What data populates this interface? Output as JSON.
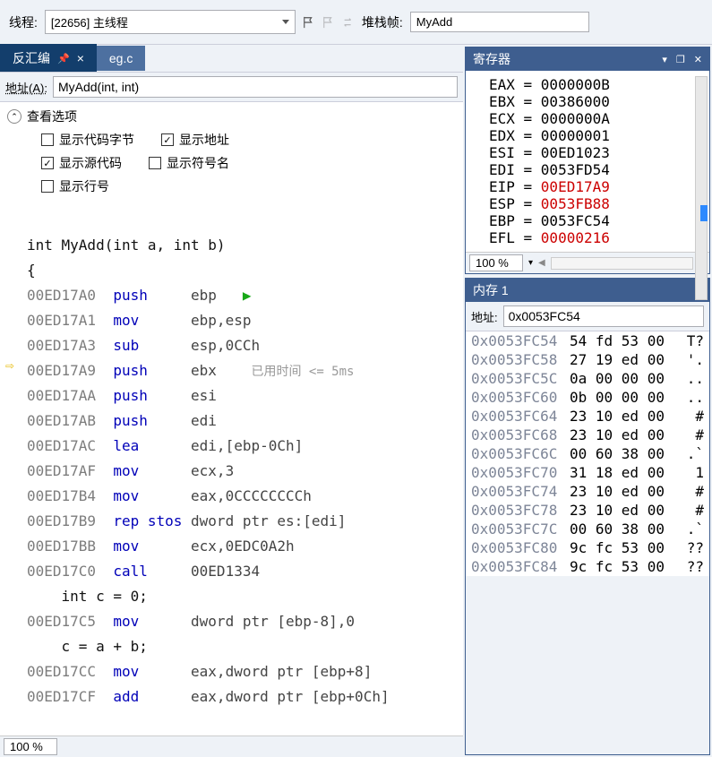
{
  "topbar": {
    "threads_label": "线程:",
    "thread_value": "[22656] 主线程",
    "stack_label": "堆栈帧:",
    "stack_value": "MyAdd"
  },
  "tabs": {
    "active": "反汇编",
    "inactive": "eg.c"
  },
  "address_bar": {
    "label": "地址(A):",
    "value": "MyAdd(int, int)"
  },
  "options": {
    "title": "查看选项",
    "show_code_bytes": "显示代码字节",
    "show_address": "显示地址",
    "show_source": "显示源代码",
    "show_symbol": "显示符号名",
    "show_line": "显示行号"
  },
  "asm": {
    "src_sig": "int MyAdd(int a, int b)",
    "brace_open": "{",
    "lines": [
      {
        "addr": "00ED17A0",
        "op": "push",
        "opd": "ebp",
        "green": true
      },
      {
        "addr": "00ED17A1",
        "op": "mov",
        "opd": "ebp,esp"
      },
      {
        "addr": "00ED17A3",
        "op": "sub",
        "opd": "esp,0CCh"
      },
      {
        "addr": "00ED17A9",
        "op": "push",
        "opd": "ebx",
        "cur": true,
        "hint": "已用时间 <= 5ms"
      },
      {
        "addr": "00ED17AA",
        "op": "push",
        "opd": "esi"
      },
      {
        "addr": "00ED17AB",
        "op": "push",
        "opd": "edi"
      },
      {
        "addr": "00ED17AC",
        "op": "lea",
        "opd": "edi,[ebp-0Ch]"
      },
      {
        "addr": "00ED17AF",
        "op": "mov",
        "opd": "ecx,3"
      },
      {
        "addr": "00ED17B4",
        "op": "mov",
        "opd": "eax,0CCCCCCCCh"
      },
      {
        "addr": "00ED17B9",
        "op": "rep stos",
        "opd": "dword ptr es:[edi]"
      },
      {
        "addr": "00ED17BB",
        "op": "mov",
        "opd": "ecx,0EDC0A2h"
      },
      {
        "addr": "00ED17C0",
        "op": "call",
        "opd": "00ED1334"
      }
    ],
    "src_c0": "int c = 0;",
    "lines2": [
      {
        "addr": "00ED17C5",
        "op": "mov",
        "opd": "dword ptr [ebp-8],0"
      }
    ],
    "src_add": "c = a + b;",
    "lines3": [
      {
        "addr": "00ED17CC",
        "op": "mov",
        "opd": "eax,dword ptr [ebp+8]"
      },
      {
        "addr": "00ED17CF",
        "op": "add",
        "opd": "eax,dword ptr [ebp+0Ch]"
      }
    ]
  },
  "zoom": "100 %",
  "registers": {
    "title": "寄存器",
    "items": [
      {
        "name": "EAX",
        "val": "0000000B",
        "red": false
      },
      {
        "name": "EBX",
        "val": "00386000",
        "red": false
      },
      {
        "name": "ECX",
        "val": "0000000A",
        "red": false
      },
      {
        "name": "EDX",
        "val": "00000001",
        "red": false
      },
      {
        "name": "ESI",
        "val": "00ED1023",
        "red": false
      },
      {
        "name": "EDI",
        "val": "0053FD54",
        "red": false
      },
      {
        "name": "EIP",
        "val": "00ED17A9",
        "red": true
      },
      {
        "name": "ESP",
        "val": "0053FB88",
        "red": true
      },
      {
        "name": "EBP",
        "val": "0053FC54",
        "red": false
      },
      {
        "name": "EFL",
        "val": "00000216",
        "red": true
      }
    ]
  },
  "memory": {
    "title": "内存 1",
    "addr_label": "地址:",
    "addr_value": "0x0053FC54",
    "rows": [
      {
        "a": "0x0053FC54",
        "b": "54 fd 53 00",
        "t": "T?"
      },
      {
        "a": "0x0053FC58",
        "b": "27 19 ed 00",
        "t": "'."
      },
      {
        "a": "0x0053FC5C",
        "b": "0a 00 00 00",
        "t": ".."
      },
      {
        "a": "0x0053FC60",
        "b": "0b 00 00 00",
        "t": ".."
      },
      {
        "a": "0x0053FC64",
        "b": "23 10 ed 00",
        "t": "#"
      },
      {
        "a": "0x0053FC68",
        "b": "23 10 ed 00",
        "t": "#"
      },
      {
        "a": "0x0053FC6C",
        "b": "00 60 38 00",
        "t": ".`"
      },
      {
        "a": "0x0053FC70",
        "b": "31 18 ed 00",
        "t": "1"
      },
      {
        "a": "0x0053FC74",
        "b": "23 10 ed 00",
        "t": "#"
      },
      {
        "a": "0x0053FC78",
        "b": "23 10 ed 00",
        "t": "#"
      },
      {
        "a": "0x0053FC7C",
        "b": "00 60 38 00",
        "t": ".`"
      },
      {
        "a": "0x0053FC80",
        "b": "9c fc 53 00",
        "t": "??"
      },
      {
        "a": "0x0053FC84",
        "b": "9c fc 53 00",
        "t": "??"
      }
    ]
  }
}
